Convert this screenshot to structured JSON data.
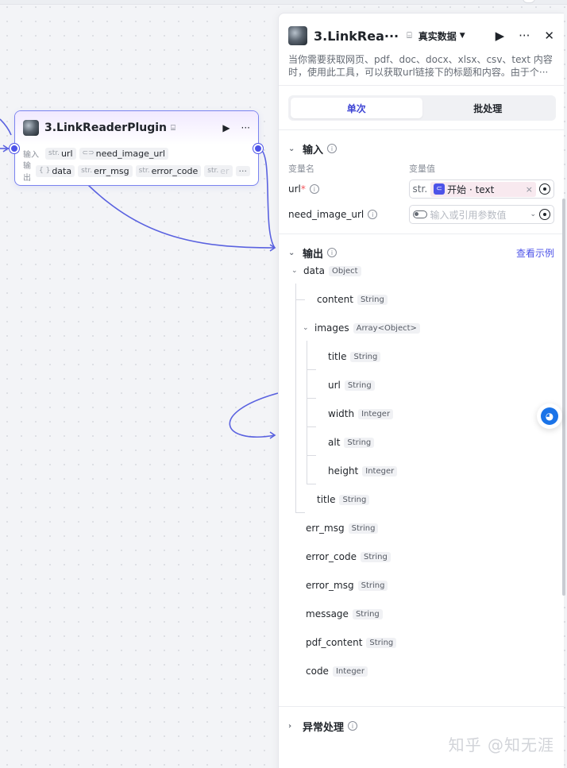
{
  "node": {
    "title": "3.LinkReaderPlugin",
    "input_label": "输入",
    "output_label": "输出",
    "inputs": [
      {
        "type": "str.",
        "name": "url"
      },
      {
        "type": "",
        "name": "need_image_url"
      }
    ],
    "outputs": [
      {
        "type": "{ }",
        "name": "data"
      },
      {
        "type": "str.",
        "name": "err_msg"
      },
      {
        "type": "str.",
        "name": "error_code"
      },
      {
        "type": "str.",
        "name": "er"
      }
    ],
    "more": "···"
  },
  "panel": {
    "title": "3.LinkRea···",
    "data_select": "真实数据",
    "description": "当你需要获取网页、pdf、doc、docx、xlsx、csv、text 内容时，使用此工具，可以获取url链接下的标题和内容。由于个···",
    "tabs": [
      {
        "label": "单次",
        "active": true
      },
      {
        "label": "批处理",
        "active": false
      }
    ],
    "input_section": {
      "title": "输入",
      "col_name": "变量名",
      "col_value": "变量值",
      "url": {
        "name": "url",
        "required_mark": "*",
        "type": "str.",
        "ref": "开始 · text"
      },
      "need_image_url": {
        "name": "need_image_url",
        "placeholder": "输入或引用参数值"
      }
    },
    "output_section": {
      "title": "输出",
      "example_link": "查看示例",
      "tree": [
        {
          "name": "data",
          "type": "Object"
        },
        {
          "name": "content",
          "type": "String"
        },
        {
          "name": "images",
          "type": "Array<Object>"
        },
        {
          "name": "title",
          "type": "String"
        },
        {
          "name": "url",
          "type": "String"
        },
        {
          "name": "width",
          "type": "Integer"
        },
        {
          "name": "alt",
          "type": "String"
        },
        {
          "name": "height",
          "type": "Integer"
        },
        {
          "name": "title",
          "type": "String"
        },
        {
          "name": "err_msg",
          "type": "String"
        },
        {
          "name": "error_code",
          "type": "String"
        },
        {
          "name": "error_msg",
          "type": "String"
        },
        {
          "name": "message",
          "type": "String"
        },
        {
          "name": "pdf_content",
          "type": "String"
        },
        {
          "name": "code",
          "type": "Integer"
        }
      ]
    },
    "exception_section": {
      "title": "异常处理"
    }
  },
  "watermark": "知乎 @知无涯",
  "colors": {
    "accent": "#4d53e8",
    "node_border": "#7a83f0",
    "ref_chip": "#f8e9ef"
  }
}
